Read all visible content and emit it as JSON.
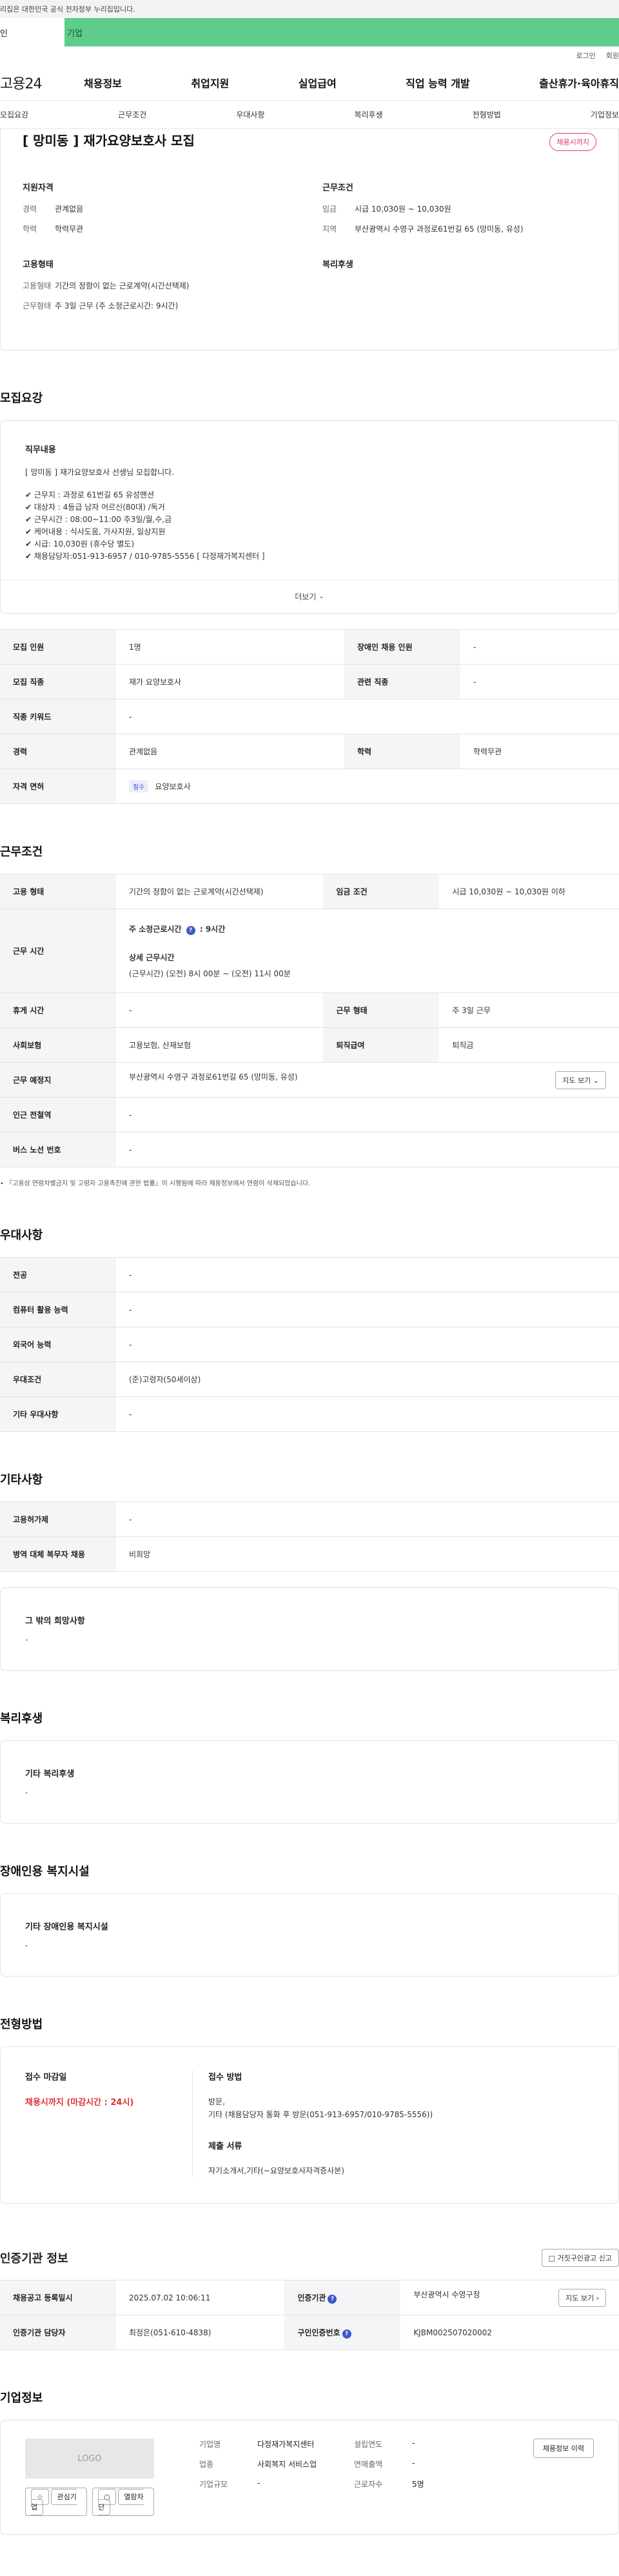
{
  "topbar": {
    "notice": "리집은 대한민국 공식 전자정부 누리집입니다."
  },
  "tabs": {
    "personal": "인",
    "company": "기업"
  },
  "util": {
    "login": "로그인",
    "join": "회원"
  },
  "gnb": {
    "logo": "고용24",
    "items": [
      "채용정보",
      "취업지원",
      "실업급여",
      "직업 능력 개발",
      "출산휴가·육아휴직"
    ]
  },
  "subnav": [
    "모집요강",
    "근무조건",
    "우대사항",
    "복리후생",
    "전형방법",
    "기업정보"
  ],
  "hero": {
    "title": "[ 망미동 ] 재가요양보호사 모집",
    "badge": "채용시까지",
    "apply_title": "지원자격",
    "apply_items": [
      {
        "k": "경력",
        "v": "관계없음"
      },
      {
        "k": "학력",
        "v": "학력무관"
      }
    ],
    "cond_title": "근무조건",
    "cond_items": [
      {
        "k": "임금",
        "v": "시급 10,030원 ~ 10,030원"
      },
      {
        "k": "지역",
        "v": "부산광역시 수영구 과정로61번길 65 (망미동, 유성)"
      }
    ],
    "emp_title": "고용형태",
    "emp_items": [
      {
        "k": "고용형태",
        "v": "기간의 정함이 없는 근로계약(시간선택제)"
      },
      {
        "k": "근무형태",
        "v": "주 3일 근무 (주 소정근로시간: 9시간)"
      }
    ],
    "welfare_title": "복리후생"
  },
  "recruit": {
    "section": "모집요강",
    "duty_title": "직무내용",
    "duty_intro": "[ 망미동 ] 재가요양보호사 선생님 모집합니다.",
    "duty_lines": [
      "✔ 근무지 : 과정로 61번길 65 유성맨션",
      "✔ 대상자 : 4등급 남자 어르신(80대) /독거",
      "✔ 근무시간 : 08:00~11:00 주3일/월,수,금",
      "✔ 케어내용 : 식사도움, 가사지원, 일상지원",
      "✔ 시급: 10,030원 (휴수당 별도)",
      "✔ 채용담당자:051-913-6957 / 010-9785-5556 [ 다정재가복지센터 ]"
    ],
    "more": "더보기",
    "rows": [
      {
        "k1": "모집 인원",
        "v1": "1명",
        "k2": "장애인 채용 인원",
        "v2": "-"
      },
      {
        "k1": "모집 직종",
        "v1": "재가 요양보호사",
        "k2": "관련 직종",
        "v2": "-"
      },
      {
        "k1": "직종 키워드",
        "v1": "-"
      },
      {
        "k1": "경력",
        "v1": "관계없음",
        "k2": "학력",
        "v2": "학력무관"
      }
    ],
    "license_k": "자격 면허",
    "license_pill": "필수",
    "license_v": "요양보호사"
  },
  "work": {
    "section": "근무조건",
    "r1": {
      "k1": "고용 형태",
      "v1": "기간의 정함이 없는 근로계약(시간선택제)",
      "k2": "임금 조건",
      "v2": "시급 10,030원 ~ 10,030원 이하"
    },
    "hours_k": "근무 시간",
    "hours_a": "주 소정근로시간",
    "hours_a_v": ": 9시간",
    "hours_b": "상세 근무시간",
    "hours_b_v": "(근무시간) (오전) 8시 00분 ~ (오전) 11시 00분",
    "r3": {
      "k1": "휴게 시간",
      "v1": "-",
      "k2": "근무 형태",
      "v2": "주 3일 근무"
    },
    "r4": {
      "k1": "사회보험",
      "v1": "고용보험, 산재보험",
      "k2": "퇴직급여",
      "v2": "퇴직금"
    },
    "place_k": "근무 예정지",
    "place_v": "부산광역시 수영구 과정로61번길 65 (망미동, 유성)",
    "map_btn": "지도 보기",
    "station_k": "인근 전철역",
    "station_v": "-",
    "bus_k": "버스 노선 번호",
    "bus_v": "-",
    "note": "• 『고용상 연령차별금지 및 고령자 고용촉진에 관한 법률』이 시행됨에 따라 채용정보에서 연령이 삭제되었습니다."
  },
  "pref": {
    "section": "우대사항",
    "rows": [
      {
        "k": "전공",
        "v": "-"
      },
      {
        "k": "컴퓨터 활용 능력",
        "v": "-"
      },
      {
        "k": "외국어 능력",
        "v": "-"
      },
      {
        "k": "우대조건",
        "v": "(준)고령자(50세이상)"
      },
      {
        "k": "기타 우대사항",
        "v": "-"
      }
    ]
  },
  "etc": {
    "section": "기타사항",
    "rows": [
      {
        "k": "고용허가제",
        "v": "-"
      },
      {
        "k": "병역 대체 복무자 채용",
        "v": "비희망"
      }
    ],
    "box_t": "그 밖의 희망사항",
    "box_v": "-"
  },
  "welfare": {
    "section": "복리후생",
    "box_t": "기타 복리후생",
    "box_v": "-"
  },
  "disabled": {
    "section": "장애인용 복지시설",
    "box_t": "기타 장애인용 복지시설",
    "box_v": "-"
  },
  "screening": {
    "section": "전형방법",
    "deadline_t": "접수 마감일",
    "deadline_v": "채용시까지 (마감시간 : 24시)",
    "method_t": "접수 방법",
    "method_v1": "방문,",
    "method_v2": "기타 (채용담당자 통화 후 방문(051-913-6957/010-9785-5556))",
    "docs_t": "제출 서류",
    "docs_v": "자기소개서,기타(~요양보호사자격증사본)"
  },
  "agency": {
    "section": "인증기관 정보",
    "report_btn": "거짓구인광고 신고",
    "r1": {
      "k1": "채용공고 등록일시",
      "v1": "2025.07.02 10:06:11",
      "k2": "인증기관",
      "v2": "부산광역시 수영구청",
      "btn": "지도 보기"
    },
    "r2": {
      "k1": "인증기관 담당자",
      "v1": "최정은(051-610-4838)",
      "k2": "구인인증번호",
      "v2": "KJBM002507020002"
    }
  },
  "company": {
    "section": "기업정보",
    "logo": "LOGO",
    "btn_fav": "관심기업",
    "btn_block": "열람차단",
    "name_k": "기업명",
    "name_v": "다정재가복지센터",
    "year_k": "설립연도",
    "year_v": "-",
    "ind_k": "업종",
    "ind_v": "사회복지 서비스업",
    "sales_k": "연매출액",
    "sales_v": "-",
    "emp_k": "근로자수",
    "emp_v": "5명",
    "size_k": "기업규모",
    "size_v": "-",
    "history_btn": "채용정보 이력"
  }
}
